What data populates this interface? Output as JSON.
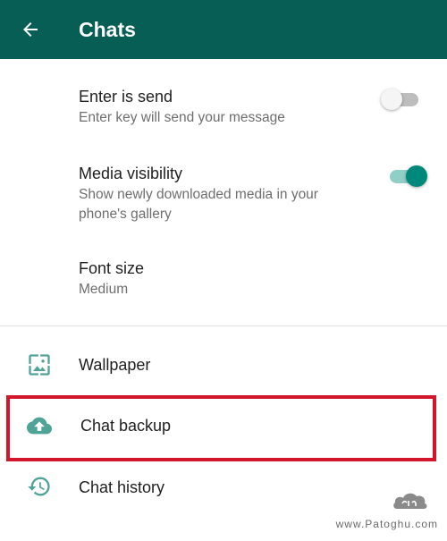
{
  "appbar": {
    "title": "Chats",
    "color": "#075e54"
  },
  "settings": [
    {
      "title": "Enter is send",
      "subtitle": "Enter key will send your message",
      "toggle": "off"
    },
    {
      "title": "Media visibility",
      "subtitle": "Show newly downloaded media in your phone's gallery",
      "toggle": "on"
    },
    {
      "title": "Font size",
      "subtitle": "Medium"
    }
  ],
  "items": [
    {
      "label": "Wallpaper",
      "icon": "wallpaper-icon"
    },
    {
      "label": "Chat backup",
      "icon": "cloud-upload-icon"
    },
    {
      "label": "Chat history",
      "icon": "history-icon"
    }
  ],
  "colors": {
    "accent": "#00897b",
    "highlight": "#d3162b"
  },
  "watermark": {
    "site": "www.Patoghu.com"
  }
}
